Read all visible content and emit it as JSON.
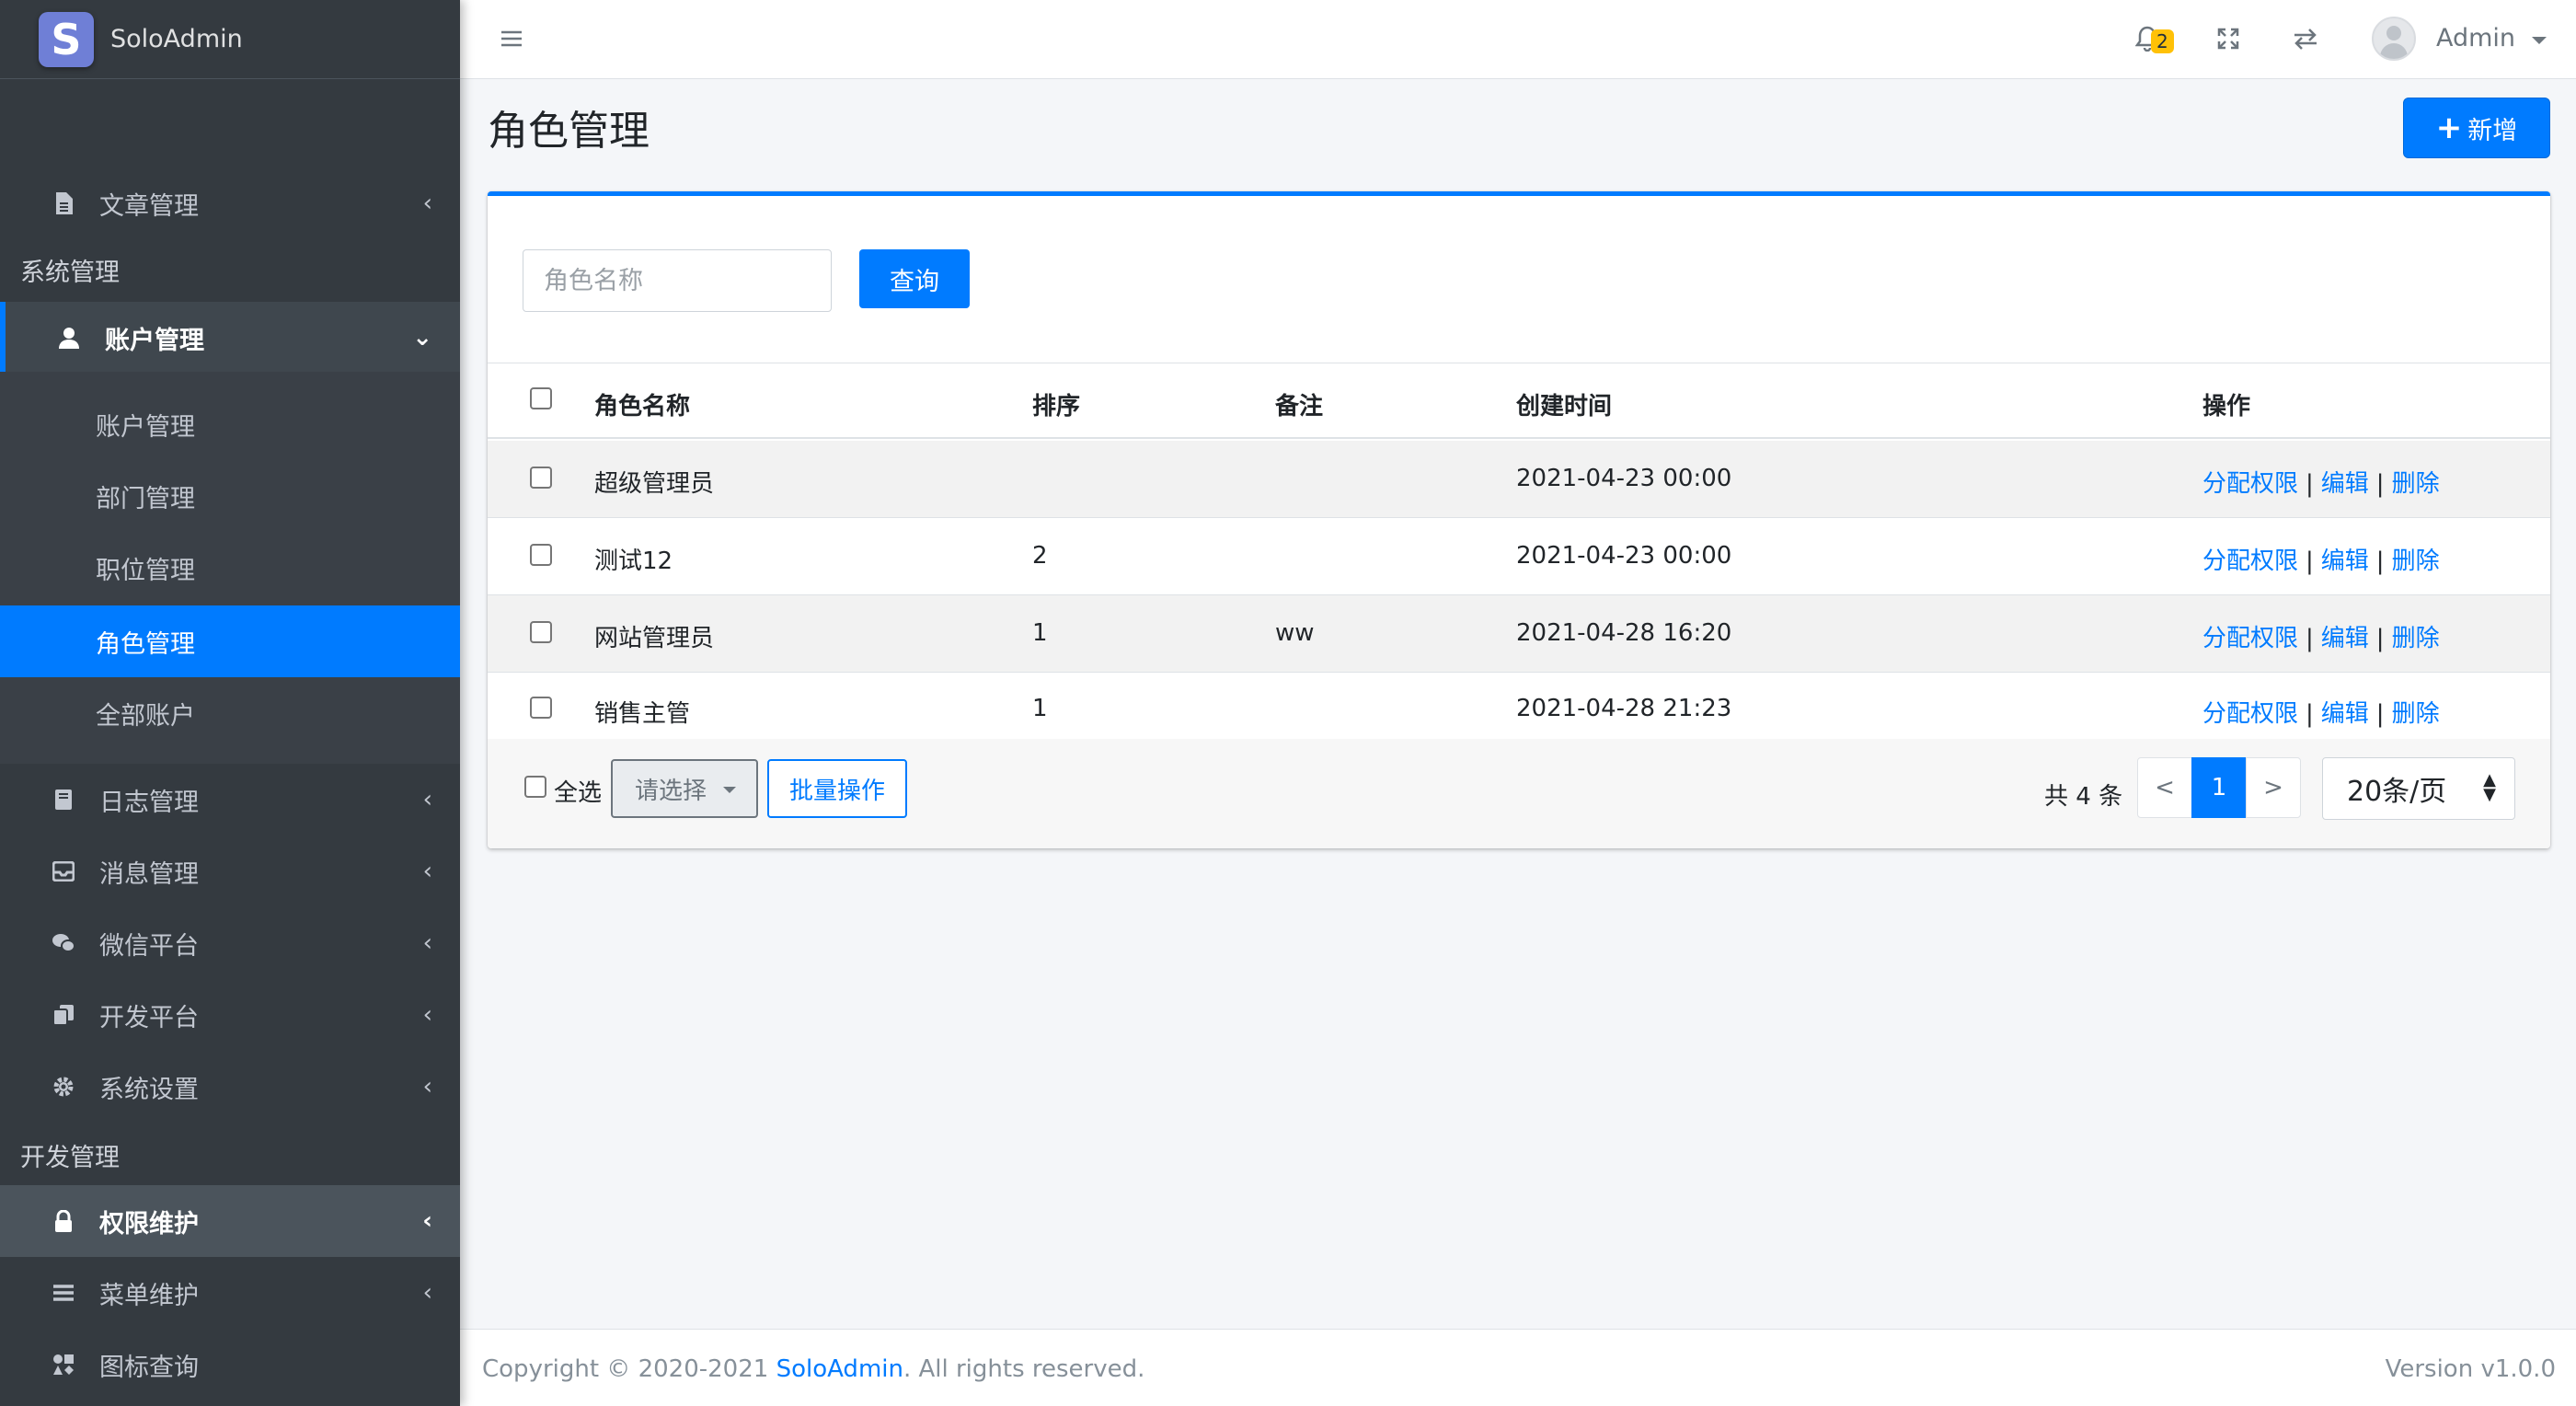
{
  "brand": {
    "logo_letter": "S",
    "name": "SoloAdmin"
  },
  "sidebar": {
    "items": [
      {
        "label": "文章管理",
        "icon": "file-icon"
      },
      {
        "label": "账户管理",
        "icon": "user-icon"
      },
      {
        "label": "日志管理",
        "icon": "book-icon"
      },
      {
        "label": "消息管理",
        "icon": "inbox-icon"
      },
      {
        "label": "微信平台",
        "icon": "wechat-icon"
      },
      {
        "label": "开发平台",
        "icon": "copy-icon"
      },
      {
        "label": "系统设置",
        "icon": "gear-icon"
      },
      {
        "label": "权限维护",
        "icon": "lock-icon"
      },
      {
        "label": "菜单维护",
        "icon": "bars-icon"
      },
      {
        "label": "图标查询",
        "icon": "icons-icon"
      }
    ],
    "headers": [
      "系统管理",
      "开发管理"
    ],
    "sub_items": [
      "账户管理",
      "部门管理",
      "职位管理",
      "角色管理",
      "全部账户"
    ],
    "active_sub": "角色管理"
  },
  "navbar": {
    "notification_count": "2",
    "user_name": "Admin"
  },
  "page": {
    "title": "角色管理",
    "add_label": "新增"
  },
  "search": {
    "placeholder": "角色名称",
    "value": "",
    "query_label": "查询"
  },
  "table": {
    "headers": [
      "角色名称",
      "排序",
      "备注",
      "创建时间",
      "操作"
    ],
    "rows": [
      {
        "name": "超级管理员",
        "sort": "",
        "remark": "",
        "created": "2021-04-23 00:00"
      },
      {
        "name": "测试12",
        "sort": "2",
        "remark": "",
        "created": "2021-04-23 00:00"
      },
      {
        "name": "网站管理员",
        "sort": "1",
        "remark": "ww",
        "created": "2021-04-28 16:20"
      },
      {
        "name": "销售主管",
        "sort": "1",
        "remark": "",
        "created": "2021-04-28 21:23"
      }
    ],
    "actions": {
      "assign": "分配权限",
      "edit": "编辑",
      "delete": "删除",
      "separator": "|"
    }
  },
  "bulk": {
    "select_all_label": "全选",
    "select_placeholder": "请选择",
    "batch_label": "批量操作"
  },
  "pagination": {
    "total_text": "共 4 条",
    "prev": "<",
    "current": "1",
    "next": ">",
    "page_size": "20条/页"
  },
  "footer": {
    "copyright_prefix": "Copyright © 2020-2021 ",
    "brand_link": "SoloAdmin",
    "copyright_suffix": ". All rights reserved.",
    "version": "Version v1.0.0"
  },
  "colors": {
    "primary": "#007bff",
    "sidebar_bg": "#343a40",
    "badge": "#ffc107"
  }
}
